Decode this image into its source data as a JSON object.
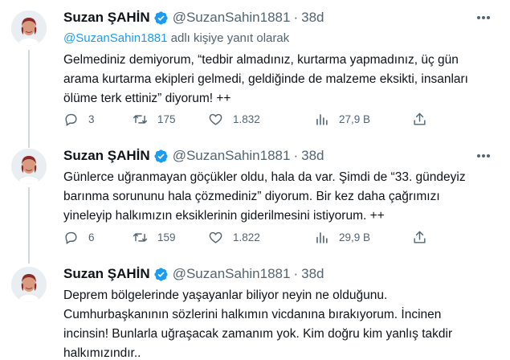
{
  "tweets": [
    {
      "author_name": "Suzan ŞAHİN",
      "handle": "@SuzanSahin1881",
      "separator": "·",
      "time": "38d",
      "reply_mention": "@SuzanSahin1881",
      "reply_suffix": " adlı kişiye yanıt olarak",
      "text": "Gelmediniz demiyorum, “tedbir almadınız, kurtarma yapmadınız, üç gün\narama kurtarma ekipleri gelmedi, geldiğinde de malzeme eksikti, insanları\nölüme terk ettiniz” diyorum! ++",
      "replies": "3",
      "retweets": "175",
      "likes": "1.832",
      "views": "27,9 B"
    },
    {
      "author_name": "Suzan ŞAHİN",
      "handle": "@SuzanSahin1881",
      "separator": "·",
      "time": "38d",
      "text": "Günlerce uğranmayan göçükler oldu, hala da var. Şimdi de “33. gündeyiz\nbarınma sorununu hala çözmediniz” diyorum. Bir kez daha çağrımızı\nyineleyip halkımızın eksiklerinin giderilmesini istiyorum. ++",
      "replies": "6",
      "retweets": "159",
      "likes": "1.822",
      "views": "29,9 B"
    },
    {
      "author_name": "Suzan ŞAHİN",
      "handle": "@SuzanSahin1881",
      "separator": "·",
      "time": "38d",
      "text": "Deprem bölgelerinde yaşayanlar biliyor neyin ne olduğunu.\nCumhurbaşkanının sözlerini halkımın vicdanına bırakıyorum. İncinen\nincinsin! Bunlarla uğraşacak zamanım yok. Kim doğru kim yanlış takdir\nhalkımızındır.."
    }
  ],
  "colors": {
    "text": "#0f1419",
    "secondary": "#536471",
    "link": "#1d9bf0",
    "verified": "#1d9bf0",
    "thread_line": "#cfd9de"
  },
  "icons": {
    "reply": "reply-icon",
    "retweet": "retweet-icon",
    "like": "heart-icon",
    "views": "analytics-icon",
    "share": "share-icon",
    "more": "more-icon",
    "verified": "verified-badge-icon"
  }
}
